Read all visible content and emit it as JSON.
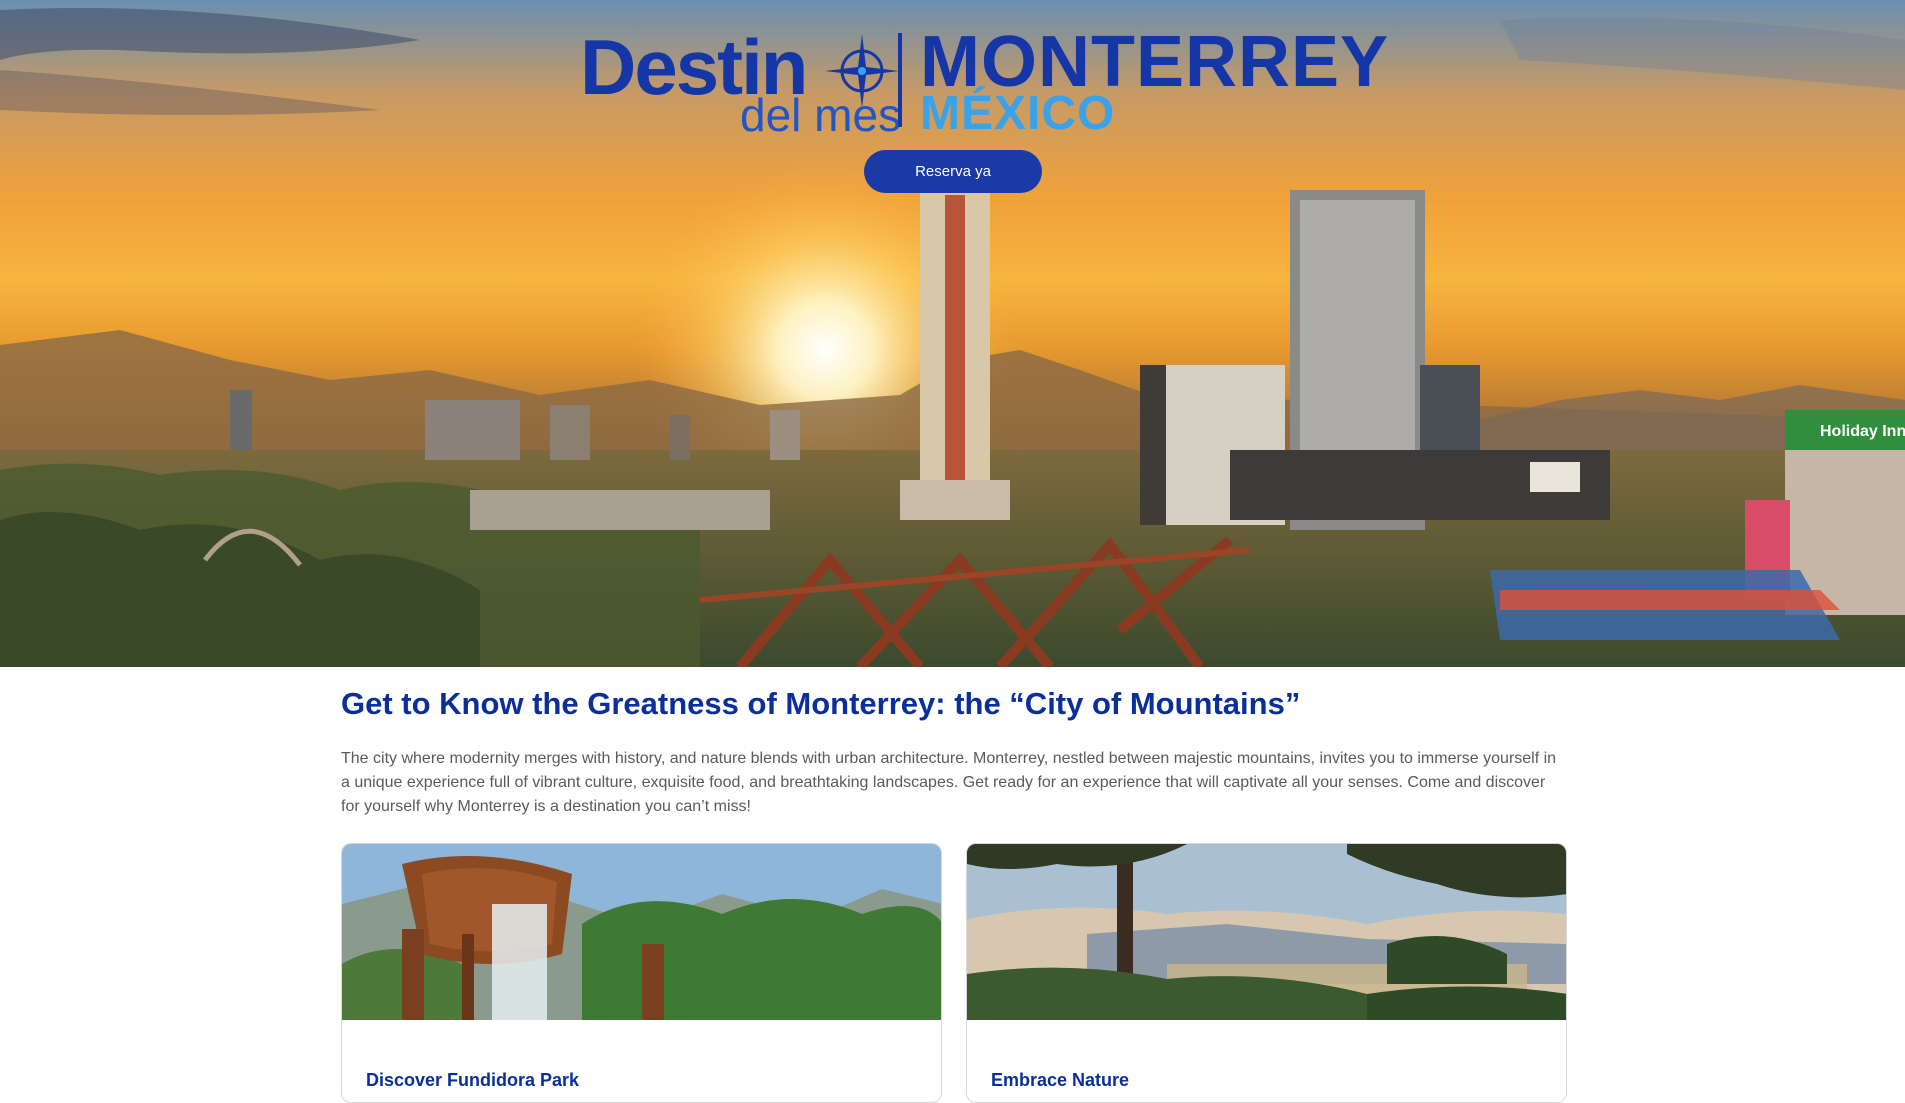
{
  "hero": {
    "brand": {
      "destino": "Destin",
      "del_mes": "del mes",
      "city": "MONTERREY",
      "country": "MÉXICO"
    },
    "cta_label": "Reserva ya",
    "building_sign": "Holiday Inn"
  },
  "main": {
    "heading": "Get to Know the Greatness of Monterrey: the “City of Mountains”",
    "intro": "The city where modernity merges with history, and nature blends with urban architecture. Monterrey, nestled between majestic mountains, invites you to immerse yourself in a unique experience full of vibrant culture, exquisite food, and breathtaking landscapes. Get ready for an experience that will captivate all your senses. Come and discover for yourself why Monterrey is a destination you can’t miss!",
    "cards": [
      {
        "title": "Discover Fundidora Park"
      },
      {
        "title": "Embrace Nature"
      }
    ]
  },
  "colors": {
    "brand_blue": "#1536a6",
    "light_blue": "#3aa2e8",
    "heading_blue": "#0a2e9a"
  }
}
